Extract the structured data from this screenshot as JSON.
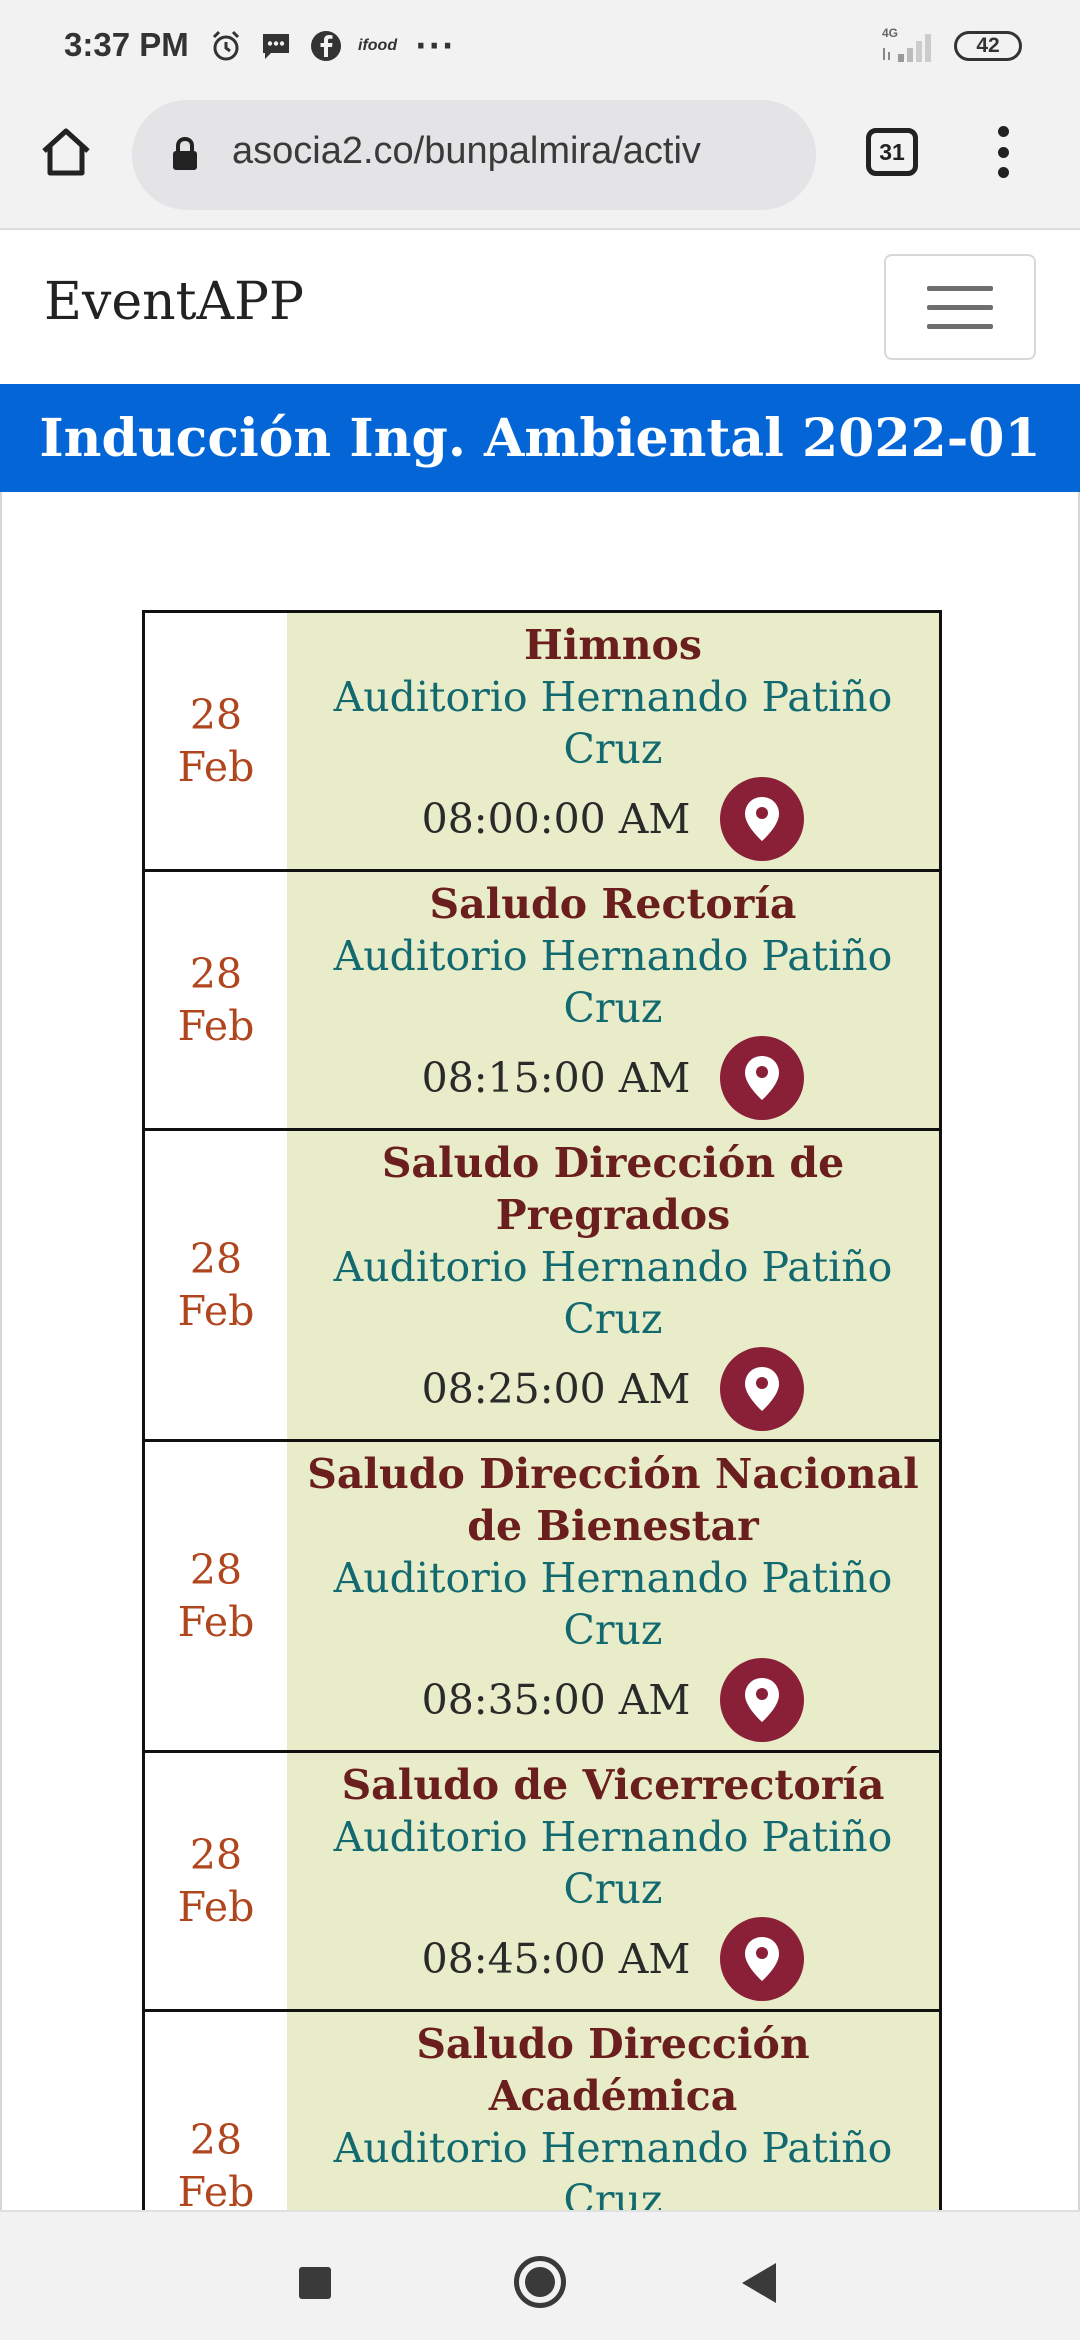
{
  "status_bar": {
    "time": "3:37 PM",
    "icons": [
      "alarm-icon",
      "message-icon",
      "facebook-icon",
      "ifood-icon",
      "more-notifications-icon"
    ],
    "ifood_label": "ifood",
    "more_dots": "···",
    "network_label": "4G",
    "battery_level": "42"
  },
  "browser": {
    "url": "asocia2.co/bunpalmira/activ",
    "tab_count": "31"
  },
  "app": {
    "brand": "EventAPP"
  },
  "page": {
    "title": "Inducción Ing. Ambiental 2022-01",
    "title_bg": "#0466d6"
  },
  "colors": {
    "date": "#b0461e",
    "event_title": "#6b1e1e",
    "venue": "#126a70",
    "row_bg": "#e8ecc8",
    "pin_button": "#8a1f38"
  },
  "events": [
    {
      "day": "28",
      "month": "Feb",
      "title_lines": [
        "Himnos"
      ],
      "venue_lines": [
        "Auditorio Hernando Patiño",
        "Cruz"
      ],
      "time": "08:00:00 AM"
    },
    {
      "day": "28",
      "month": "Feb",
      "title_lines": [
        "Saludo Rectoría"
      ],
      "venue_lines": [
        "Auditorio Hernando Patiño",
        "Cruz"
      ],
      "time": "08:15:00 AM"
    },
    {
      "day": "28",
      "month": "Feb",
      "title_lines": [
        "Saludo Dirección de",
        "Pregrados"
      ],
      "venue_lines": [
        "Auditorio Hernando Patiño",
        "Cruz"
      ],
      "time": "08:25:00 AM"
    },
    {
      "day": "28",
      "month": "Feb",
      "title_lines": [
        "Saludo Dirección Nacional",
        "de Bienestar"
      ],
      "venue_lines": [
        "Auditorio Hernando Patiño",
        "Cruz"
      ],
      "time": "08:35:00 AM"
    },
    {
      "day": "28",
      "month": "Feb",
      "title_lines": [
        "Saludo de Vicerrectoría"
      ],
      "venue_lines": [
        "Auditorio Hernando Patiño",
        "Cruz"
      ],
      "time": "08:45:00 AM"
    },
    {
      "day": "28",
      "month": "Feb",
      "title_lines": [
        "Saludo Dirección Académica"
      ],
      "venue_lines": [
        "Auditorio Hernando Patiño",
        "Cruz"
      ],
      "time": ""
    }
  ]
}
